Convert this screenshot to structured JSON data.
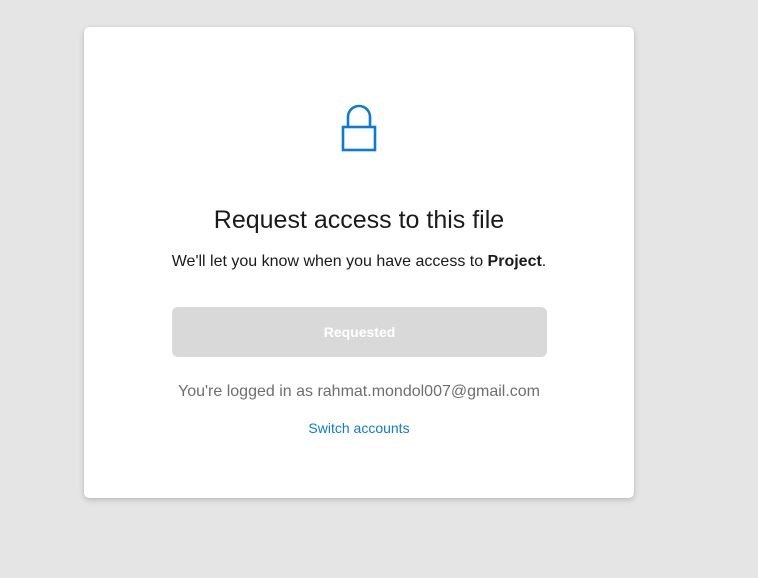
{
  "dialog": {
    "title": "Request access to this file",
    "subtitle_prefix": "We'll let you know when you have access to ",
    "file_name": "Project",
    "subtitle_suffix": ".",
    "icon": "lock-icon",
    "requested_label": "Requested",
    "logged_in_text": "You're logged in as rahmat.mondol007@gmail.com",
    "switch_accounts_label": "Switch accounts"
  },
  "colors": {
    "background": "#e5e5e5",
    "card": "#ffffff",
    "accent": "#0d7bd6",
    "disabled_button": "#d9d9d9",
    "muted_text": "#6e6e6e"
  }
}
